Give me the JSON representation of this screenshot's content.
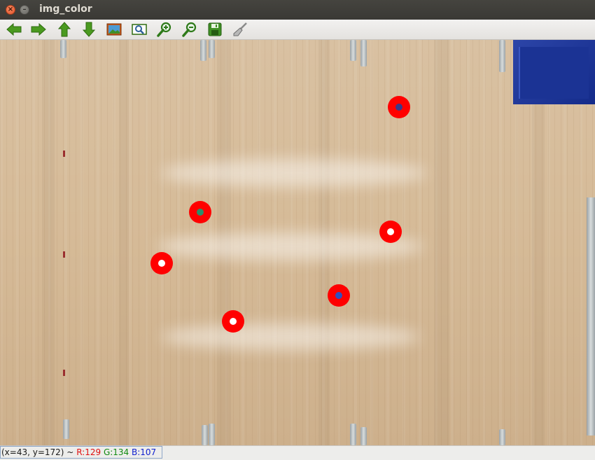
{
  "window": {
    "title": "img_color"
  },
  "toolbar": {
    "buttons": [
      {
        "name": "pan-left",
        "icon": "arrow-left-icon"
      },
      {
        "name": "pan-right",
        "icon": "arrow-right-icon"
      },
      {
        "name": "pan-up",
        "icon": "arrow-up-icon"
      },
      {
        "name": "pan-down",
        "icon": "arrow-down-icon"
      },
      {
        "name": "zoom-reset",
        "icon": "image-icon"
      },
      {
        "name": "zoom-fit",
        "icon": "zoom-frame-icon"
      },
      {
        "name": "zoom-in",
        "icon": "zoom-in-icon"
      },
      {
        "name": "zoom-out",
        "icon": "zoom-out-icon"
      },
      {
        "name": "save",
        "icon": "save-icon"
      },
      {
        "name": "properties",
        "icon": "brush-icon"
      }
    ]
  },
  "colors": {
    "marker": "#ff0000",
    "accent_green": "#2e9b2e"
  },
  "markers": [
    {
      "inner": "#3a3a8a"
    },
    {
      "inner": "#2a8f6a"
    },
    {
      "inner": "#ffffff"
    },
    {
      "inner": "#ffffff"
    },
    {
      "inner": "#3050c0"
    },
    {
      "inner": "#ffffff"
    }
  ],
  "status": {
    "coords": "(x=43, y=172) ~",
    "r": "R:129",
    "g": "G:134",
    "b": "B:107"
  }
}
